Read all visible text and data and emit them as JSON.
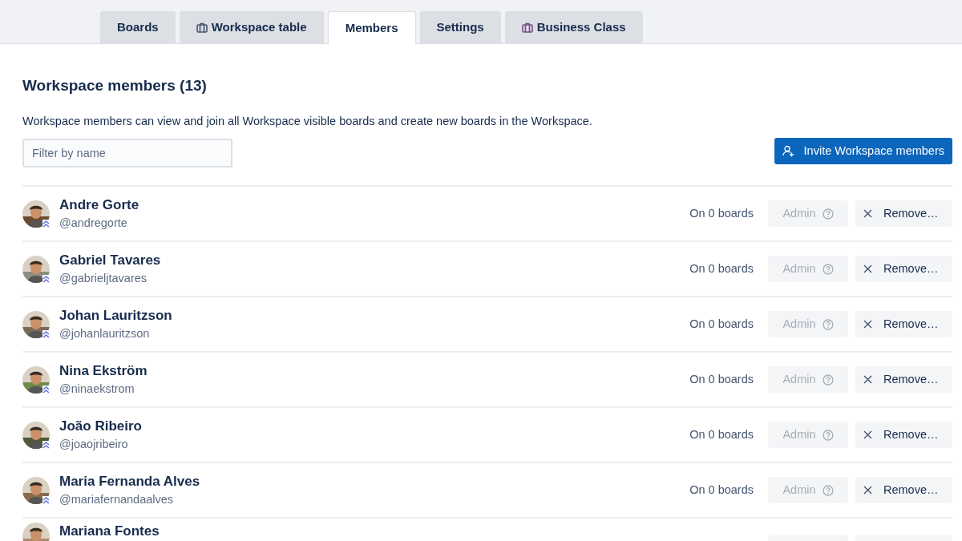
{
  "tabs": [
    {
      "label": "Boards",
      "icon": false,
      "selected": false
    },
    {
      "label": "Workspace table",
      "icon": true,
      "selected": false
    },
    {
      "label": "Members",
      "icon": false,
      "selected": true
    },
    {
      "label": "Settings",
      "icon": false,
      "selected": false
    },
    {
      "label": "Business Class",
      "icon": true,
      "selected": false
    }
  ],
  "heading": "Workspace members (13)",
  "description": "Workspace members can view and join all Workspace visible boards and create new boards in the Workspace.",
  "filter": {
    "placeholder": "Filter by name"
  },
  "invite_button": "Invite Workspace members",
  "members": [
    {
      "name": "Andre Gorte",
      "username": "@andregorte",
      "boards": "On 0 boards",
      "role": "Admin",
      "role_disabled": true,
      "remove": "Remove…"
    },
    {
      "name": "Gabriel Tavares",
      "username": "@gabrieljtavares",
      "boards": "On 0 boards",
      "role": "Admin",
      "role_disabled": true,
      "remove": "Remove…"
    },
    {
      "name": "Johan Lauritzson",
      "username": "@johanlauritzson",
      "boards": "On 0 boards",
      "role": "Admin",
      "role_disabled": true,
      "remove": "Remove…"
    },
    {
      "name": "Nina Ekström",
      "username": "@ninaekstrom",
      "boards": "On 0 boards",
      "role": "Admin",
      "role_disabled": true,
      "remove": "Remove…"
    },
    {
      "name": "João Ribeiro",
      "username": "@joaojribeiro",
      "boards": "On 0 boards",
      "role": "Admin",
      "role_disabled": true,
      "remove": "Remove…"
    },
    {
      "name": "Maria Fernanda Alves",
      "username": "@mariafernandaalves",
      "boards": "On 0 boards",
      "role": "Admin",
      "role_disabled": true,
      "remove": "Remove…"
    },
    {
      "name": "Mariana Fontes"
    }
  ]
}
